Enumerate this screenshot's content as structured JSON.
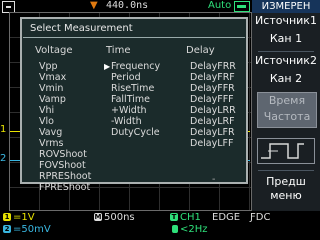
{
  "top": {
    "trig_marker": "▼",
    "timebase_position": "440.0ns",
    "trigger_mode": "Auto"
  },
  "measure_panel": {
    "title": "Select Measurement",
    "columns": [
      {
        "header": "Voltage",
        "items": [
          "Vpp",
          "Vmax",
          "Vmin",
          "Vamp",
          "Vhi",
          "Vlo",
          "Vavg",
          "Vrms",
          "ROVShoot",
          "FOVShoot",
          "RPREShoot",
          "FPREShoot"
        ]
      },
      {
        "header": "Time",
        "items": [
          "Frequency",
          "Period",
          "RiseTime",
          "FallTime",
          "+Width",
          "-Width",
          "DutyCycle"
        ]
      },
      {
        "header": "Delay",
        "items": [
          "DelayFRR",
          "DelayFRF",
          "DelayFFR",
          "DelayFFF",
          "DelayLRR",
          "DelayLRF",
          "DelayLFR",
          "DelayLFF"
        ]
      }
    ],
    "selected_marker": "▶",
    "extra_dash": "-"
  },
  "menu": {
    "title": "ИЗМЕРЕН",
    "source1_label": "Источник1",
    "source1_value": "Кан 1",
    "source2_label": "Источник2",
    "source2_value": "Кан 2",
    "disabled_line1": "Время",
    "disabled_line2": "Частота",
    "prev_line1": "Предш",
    "prev_line2": "меню"
  },
  "channels": {
    "ch1_marker": "1",
    "ch2_marker": "2"
  },
  "bottom": {
    "ch1_badge": "1",
    "ch1_scale": "1V",
    "ch2_badge": "2",
    "ch2_scale": "50mV",
    "time_badge": "M",
    "timebase": "500ns",
    "trig_badge": "T",
    "trig_source": "CH1",
    "trig_edge": "EDGE",
    "coupling": "ƑDC",
    "freq": "<2Hz"
  },
  "colors": {
    "ch1": "#e8e300",
    "ch2": "#39b6e0",
    "trigger": "#2ee07a",
    "menu_title_bg": "#16345a",
    "panel_bg": "#1b2b2b"
  }
}
